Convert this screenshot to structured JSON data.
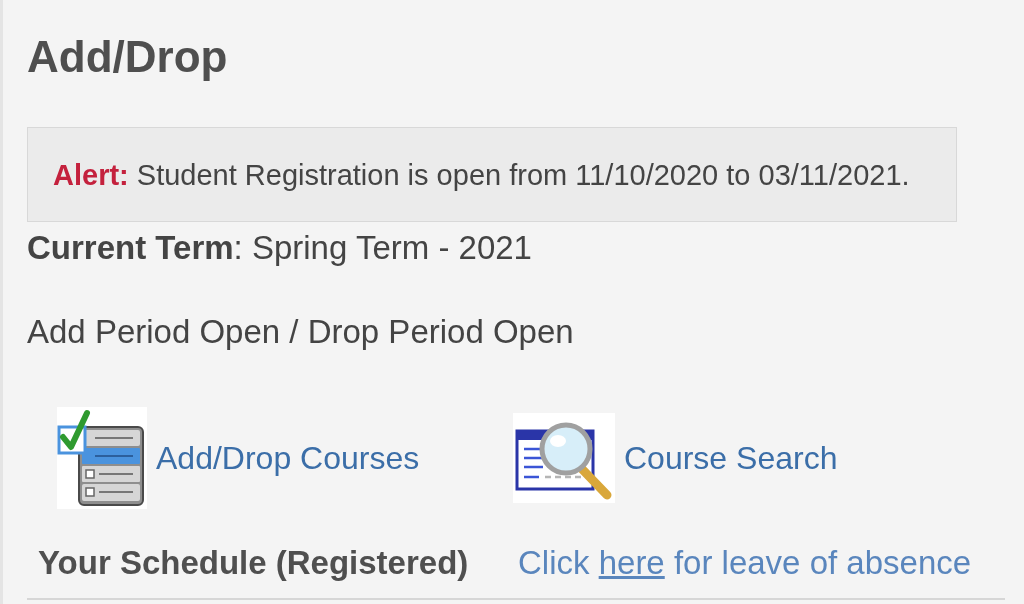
{
  "page_title": "Add/Drop",
  "alert": {
    "label": "Alert:",
    "message": "Student Registration is open from 11/10/2020 to 03/11/2021."
  },
  "current_term": "**Current Term**: Spring Term - 2021",
  "period_status": "Add Period Open / Drop Period Open",
  "actions": [
    {
      "kind": "add_drop",
      "label": "Add/Drop Courses"
    },
    {
      "kind": "search",
      "label": "Course Search"
    }
  ],
  "schedule_heading": "Your Schedule (Registered)",
  "leave_of_absence": {
    "before": "Click",
    "link": "here",
    "after": "for leave of absence"
  }
}
